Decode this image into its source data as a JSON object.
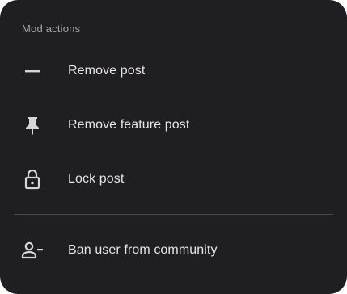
{
  "sheet": {
    "section_title": "Mod actions",
    "items": [
      {
        "label": "Remove post",
        "icon": "minus-icon"
      },
      {
        "label": "Remove feature post",
        "icon": "pin-icon"
      },
      {
        "label": "Lock post",
        "icon": "lock-icon"
      },
      {
        "label": "Ban user from community",
        "icon": "ban-user-icon"
      }
    ]
  },
  "colors": {
    "background": "#1f1e22",
    "text": "#e8e3e8",
    "muted": "#a9a4ac",
    "divider": "#49464d"
  }
}
